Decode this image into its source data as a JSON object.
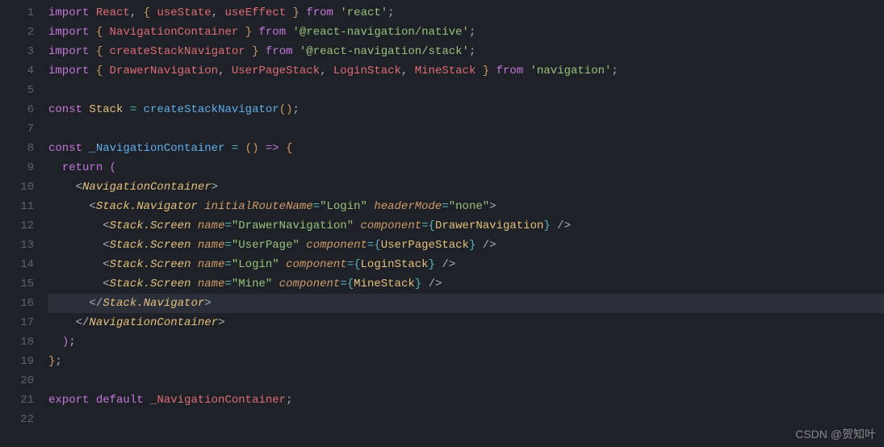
{
  "watermark": "CSDN @贺知叶",
  "highlight_line": 16,
  "gutter": [
    "1",
    "2",
    "3",
    "4",
    "5",
    "6",
    "7",
    "8",
    "9",
    "10",
    "11",
    "12",
    "13",
    "14",
    "15",
    "16",
    "17",
    "18",
    "19",
    "20",
    "21",
    "22"
  ],
  "code": {
    "l1": {
      "import": "import",
      "react": "React",
      "comma": ", ",
      "lb": "{ ",
      "useState": "useState",
      "comma2": ", ",
      "useEffect": "useEffect",
      "rb": " }",
      "from": " from ",
      "str": "'react'",
      "semi": ";"
    },
    "l2": {
      "import": "import",
      "lb": " { ",
      "nc": "NavigationContainer",
      "rb": " } ",
      "from": "from ",
      "str": "'@react-navigation/native'",
      "semi": ";"
    },
    "l3": {
      "import": "import",
      "lb": " { ",
      "csn": "createStackNavigator",
      "rb": " } ",
      "from": "from ",
      "str": "'@react-navigation/stack'",
      "semi": ";"
    },
    "l4": {
      "import": "import",
      "lb": " { ",
      "dn": "DrawerNavigation",
      "c1": ", ",
      "ups": "UserPageStack",
      "c2": ", ",
      "ls": "LoginStack",
      "c3": ", ",
      "ms": "MineStack",
      "rb": " } ",
      "from": "from ",
      "str": "'navigation'",
      "semi": ";"
    },
    "l6": {
      "const": "const",
      "sp": " ",
      "stack": "Stack",
      "eq": " = ",
      "fn": "createStackNavigator",
      "paren": "()",
      "semi": ";"
    },
    "l8": {
      "const": "const",
      "sp": " ",
      "name": "_NavigationContainer",
      "eq": " = ",
      "lp": "(",
      "rp": ")",
      "arrow": " => ",
      "lb": "{"
    },
    "l9": {
      "return": "return",
      "sp": " ",
      "lp": "("
    },
    "l10": {
      "lt": "<",
      "tag": "NavigationContainer",
      "gt": ">"
    },
    "l11": {
      "lt": "<",
      "tag": "Stack.Navigator",
      "sp": " ",
      "a1": "initialRouteName",
      "eq1": "=",
      "v1": "\"Login\"",
      "sp2": " ",
      "a2": "headerMode",
      "eq2": "=",
      "v2": "\"none\"",
      "gt": ">"
    },
    "l12": {
      "lt": "<",
      "tag": "Stack.Screen",
      "sp": " ",
      "a1": "name",
      "eq1": "=",
      "v1": "\"DrawerNavigation\"",
      "sp2": " ",
      "a2": "component",
      "eq2": "=",
      "lb": "{",
      "comp": "DrawerNavigation",
      "rb": "}",
      "close": " />"
    },
    "l13": {
      "lt": "<",
      "tag": "Stack.Screen",
      "sp": " ",
      "a1": "name",
      "eq1": "=",
      "v1": "\"UserPage\"",
      "sp2": " ",
      "a2": "component",
      "eq2": "=",
      "lb": "{",
      "comp": "UserPageStack",
      "rb": "}",
      "close": " />"
    },
    "l14": {
      "lt": "<",
      "tag": "Stack.Screen",
      "sp": " ",
      "a1": "name",
      "eq1": "=",
      "v1": "\"Login\"",
      "sp2": " ",
      "a2": "component",
      "eq2": "=",
      "lb": "{",
      "comp": "LoginStack",
      "rb": "}",
      "close": " />"
    },
    "l15": {
      "lt": "<",
      "tag": "Stack.Screen",
      "sp": " ",
      "a1": "name",
      "eq1": "=",
      "v1": "\"Mine\"",
      "sp2": " ",
      "a2": "component",
      "eq2": "=",
      "lb": "{",
      "comp": "MineStack",
      "rb": "}",
      "close": " />"
    },
    "l16": {
      "lt": "</",
      "tag": "Stack.Navigator",
      "gt": ">"
    },
    "l17": {
      "lt": "</",
      "tag": "NavigationContainer",
      "gt": ">"
    },
    "l18": {
      "rp": ")",
      "semi": ";"
    },
    "l19": {
      "rb": "}",
      "semi": ";"
    },
    "l21": {
      "export": "export",
      "sp": " ",
      "default": "default",
      "sp2": " ",
      "name": "_NavigationContainer",
      "semi": ";"
    }
  }
}
